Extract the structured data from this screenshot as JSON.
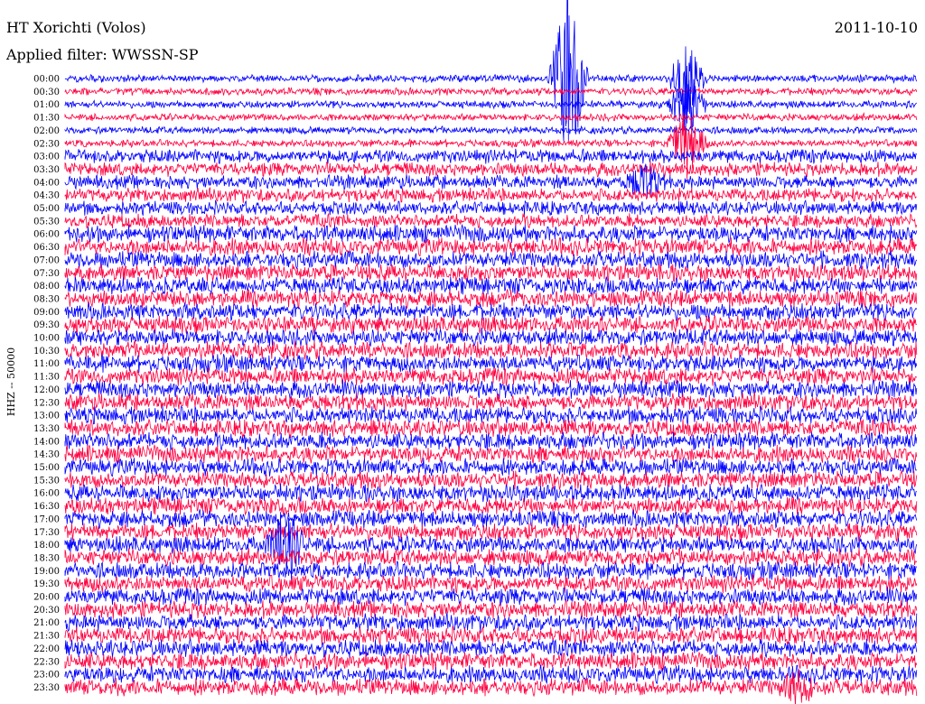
{
  "header": {
    "station": "HT Xorichti (Volos)",
    "date": "2011-10-10",
    "filter": "Applied filter: WWSSN-SP"
  },
  "colors": {
    "trace_a": "#0000ff",
    "trace_b": "#ff0040",
    "background": "#ffffff",
    "text": "#000000"
  },
  "chart_data": {
    "type": "line",
    "ylabel": "HHZ -- 50000",
    "rows": 48,
    "row_interval_minutes": 30,
    "series_colors_alternate": [
      "#0000ff",
      "#ff0040"
    ],
    "tick_labels": [
      "00:00",
      "00:30",
      "01:00",
      "01:30",
      "02:00",
      "02:30",
      "03:00",
      "03:30",
      "04:00",
      "04:30",
      "05:00",
      "05:30",
      "06:00",
      "06:30",
      "07:00",
      "07:30",
      "08:00",
      "08:30",
      "09:00",
      "09:30",
      "10:00",
      "10:30",
      "11:00",
      "11:30",
      "12:00",
      "12:30",
      "13:00",
      "13:30",
      "14:00",
      "14:30",
      "15:00",
      "15:30",
      "16:00",
      "16:30",
      "17:00",
      "17:30",
      "18:00",
      "18:30",
      "19:00",
      "19:30",
      "20:00",
      "20:30",
      "21:00",
      "21:30",
      "22:00",
      "22:30",
      "23:00",
      "23:30"
    ],
    "events": [
      {
        "row": 0,
        "time_fraction": 0.59,
        "amplitude": "extreme"
      },
      {
        "row": 0,
        "time_fraction": 0.73,
        "amplitude": "high"
      },
      {
        "row": 2,
        "time_fraction": 0.73,
        "amplitude": "high"
      },
      {
        "row": 5,
        "time_fraction": 0.73,
        "amplitude": "high"
      },
      {
        "row": 8,
        "time_fraction": 0.68,
        "amplitude": "medium"
      },
      {
        "row": 36,
        "time_fraction": 0.26,
        "amplitude": "high"
      },
      {
        "row": 47,
        "time_fraction": 0.86,
        "amplitude": "medium"
      }
    ]
  }
}
